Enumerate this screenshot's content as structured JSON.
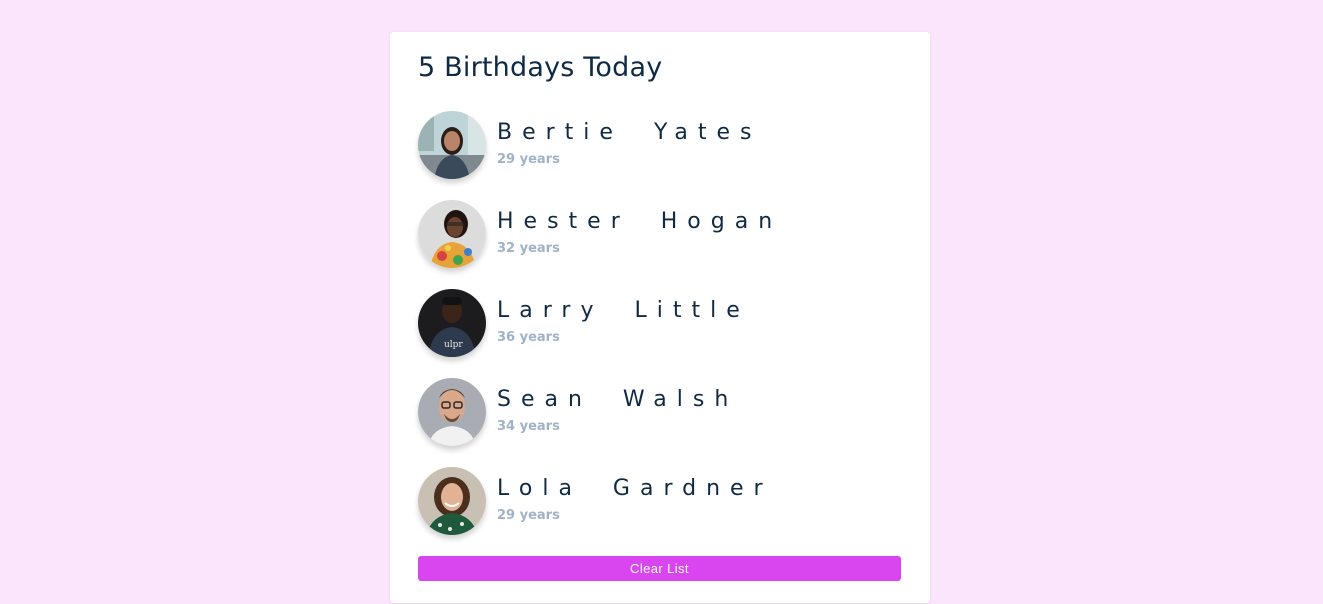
{
  "header": {
    "title": "5 Birthdays Today"
  },
  "people": [
    {
      "name": "Bertie Yates",
      "age": "29 years",
      "avatar": "avatar-photo-woman-city"
    },
    {
      "name": "Hester Hogan",
      "age": "32 years",
      "avatar": "avatar-photo-woman-floral"
    },
    {
      "name": "Larry Little",
      "age": "36 years",
      "avatar": "avatar-photo-man-dark"
    },
    {
      "name": "Sean Walsh",
      "age": "34 years",
      "avatar": "avatar-photo-man-glasses"
    },
    {
      "name": "Lola Gardner",
      "age": "29 years",
      "avatar": "avatar-photo-woman-smiling"
    }
  ],
  "actions": {
    "clear_label": "Clear List"
  },
  "colors": {
    "page_background": "#fae5fc",
    "card_background": "#ffffff",
    "button": "#d946ef",
    "name_text": "#102a43",
    "age_text": "#9fb3c8"
  }
}
